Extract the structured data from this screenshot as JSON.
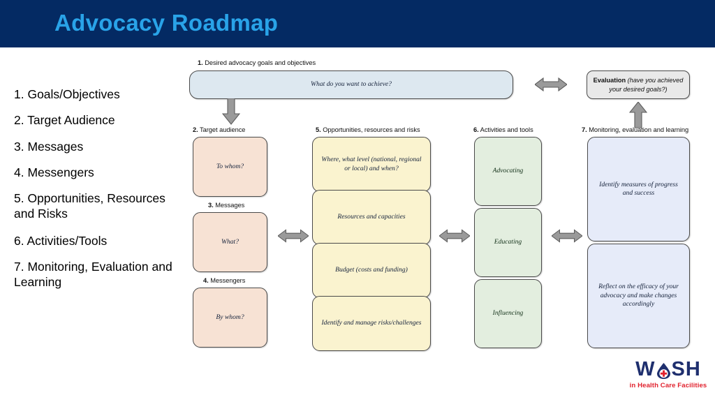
{
  "header": {
    "title": "Advocacy Roadmap",
    "bg_color": "#042a63",
    "title_color": "#29a3e8"
  },
  "left_list": {
    "items": [
      "1. Goals/Objectives",
      "2. Target Audience",
      "3. Messages",
      "4. Messengers",
      "5. Opportunities, Resources and Risks",
      "6. Activities/Tools",
      "7. Monitoring, Evaluation and Learning"
    ]
  },
  "diagram": {
    "captions": {
      "step1": "1. Desired advocacy goals and objectives",
      "step2": "2. Target audience",
      "step3": "3. Messages",
      "step4": "4. Messengers",
      "step5": "5. Opportunities, resources and risks",
      "step6": "6. Activities and tools",
      "step7": "7. Monitoring, evaluation and learning"
    },
    "caption_numbers": {
      "step1": "1.",
      "step2": "2.",
      "step3": "3.",
      "step4": "4.",
      "step5": "5.",
      "step6": "6.",
      "step7": "7."
    },
    "caption_text": {
      "step1": " Desired advocacy goals and objectives",
      "step2": " Target audience",
      "step3": " Messages",
      "step4": " Messengers",
      "step5": " Opportunities, resources and risks",
      "step6": " Activities and tools",
      "step7": " Monitoring, evaluation and learning"
    },
    "boxes": {
      "goal": "What do you want to achieve?",
      "evaluation_strong": "Evaluation ",
      "evaluation_italic": "(have you achieved your desired goals?)",
      "target_audience": "To whom?",
      "messages": "What?",
      "messengers": "By whom?",
      "opportunity_where": "Where, what level (national, regional or local) and when?",
      "opportunity_resources": "Resources and capacities",
      "opportunity_budget": "Budget (costs and funding)",
      "opportunity_risks": "Identify and manage risks/challenges",
      "activity_advocating": "Advocating",
      "activity_educating": "Educating",
      "activity_influencing": "Influencing",
      "mel_measures": "Identify measures of progress and success",
      "mel_reflect": "Reflect on the efficacy of your advocacy and make changes accordingly"
    },
    "colors": {
      "goal_box": "#dde8f0",
      "audience_boxes": "#f7e2d4",
      "opportunity_boxes": "#faf3cf",
      "activity_boxes": "#e3eedf",
      "mel_boxes": "#e6ebf9",
      "evaluation_box": "#e9e9e9",
      "arrow_fill": "#9a9a9a",
      "box_border": "#4a4a4a"
    }
  },
  "logo": {
    "word_part1": "W",
    "word_part2": "SH",
    "tagline": "in Health Care Facilities",
    "word_color": "#1f2f6e",
    "tagline_color": "#e1222e",
    "drop_color": "#1f2f6e",
    "cross_color": "#e1222e"
  }
}
